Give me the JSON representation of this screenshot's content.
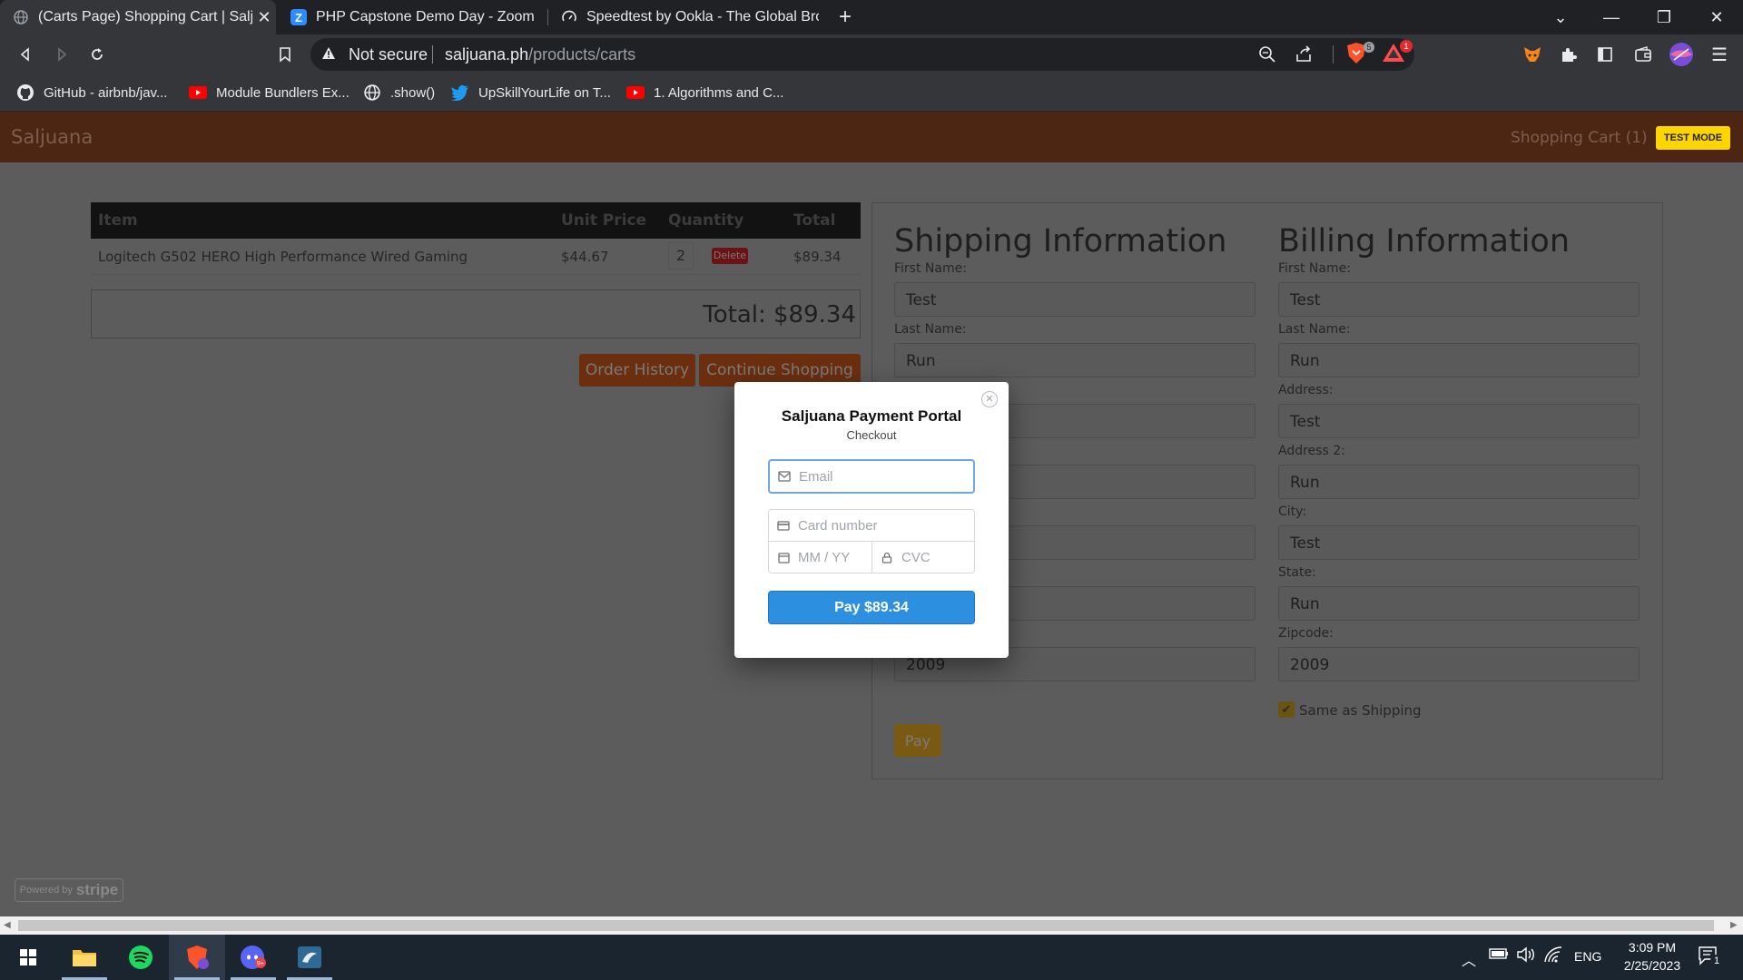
{
  "browser": {
    "tabs": [
      {
        "title": "(Carts Page) Shopping Cart | Saljuana",
        "active": true,
        "icon": "globe-icon"
      },
      {
        "title": "PHP Capstone Demo Day - Zoom",
        "active": false,
        "icon": "zoom-icon"
      },
      {
        "title": "Speedtest by Ookla - The Global Broadband",
        "active": false,
        "icon": "speedtest-icon"
      }
    ],
    "new_tab": "+",
    "security_label": "Not secure",
    "url_host": "saljuana.ph",
    "url_path": "/products/carts",
    "brave_shield_count": "5",
    "rewards_count": "1",
    "bookmarks": [
      {
        "label": "GitHub - airbnb/jav...",
        "icon": "github-icon"
      },
      {
        "label": "Module Bundlers Ex...",
        "icon": "youtube-icon"
      },
      {
        "label": ".show()",
        "icon": "globe-icon"
      },
      {
        "label": "UpSkillYourLife on T...",
        "icon": "twitter-icon"
      },
      {
        "label": "1. Algorithms and C...",
        "icon": "youtube-icon"
      }
    ]
  },
  "site": {
    "brand": "Saljuana",
    "cart_link": "Shopping Cart (1)",
    "test_mode": "TEST MODE"
  },
  "cart": {
    "headers": [
      "Item",
      "Unit Price",
      "Quantity",
      "Total"
    ],
    "rows": [
      {
        "item": "Logitech G502 HERO High Performance Wired Gaming",
        "unit_price": "$44.67",
        "quantity": "2",
        "delete": "Delete",
        "total": "$89.34"
      }
    ],
    "total_label": "Total: $89.34",
    "order_history": "Order History",
    "continue_shopping": "Continue Shopping"
  },
  "shipping": {
    "title": "Shipping Information",
    "first_name_label": "First Name:",
    "first_name": "Test",
    "last_name_label": "Last Name:",
    "last_name": "Run",
    "zipcode": "2009",
    "pay": "Pay"
  },
  "billing": {
    "title": "Billing Information",
    "first_name_label": "First Name:",
    "first_name": "Test",
    "last_name_label": "Last Name:",
    "last_name": "Run",
    "address_label": "Address:",
    "address": "Test",
    "address2_label": "Address 2:",
    "address2": "Run",
    "city_label": "City:",
    "city": "Test",
    "state_label": "State:",
    "state": "Run",
    "zipcode_label": "Zipcode:",
    "zipcode": "2009",
    "same_as_shipping": "Same as Shipping",
    "same_as_shipping_checked": true
  },
  "stripe_modal": {
    "title": "Saljuana Payment Portal",
    "subtitle": "Checkout",
    "email_placeholder": "Email",
    "card_placeholder": "Card number",
    "expiry_placeholder": "MM / YY",
    "cvc_placeholder": "CVC",
    "pay_button": "Pay $89.34"
  },
  "stripe_badge": {
    "powered_by": "Powered by",
    "brand": "stripe"
  },
  "taskbar": {
    "language": "ENG",
    "time": "3:09 PM",
    "date": "2/25/2023",
    "notification_count": "1"
  },
  "colors": {
    "brand_orange": "#c0541f",
    "stripe_blue": "#2d8fe0",
    "test_mode_yellow": "#ffd500",
    "delete_red": "#e0242e"
  }
}
